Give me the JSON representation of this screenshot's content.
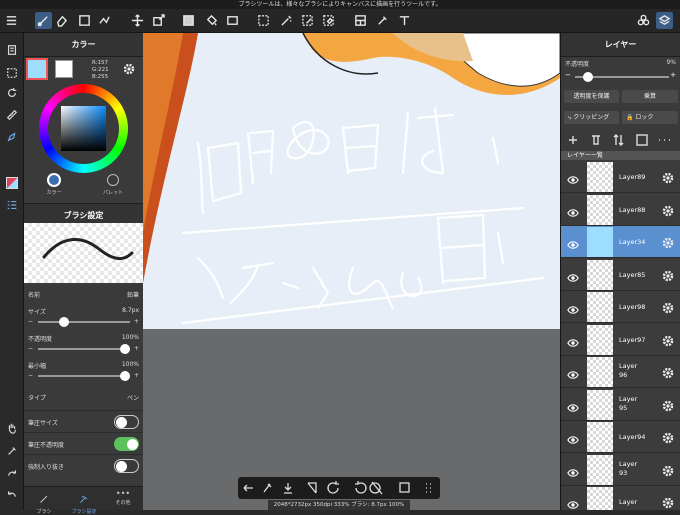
{
  "hint_text": "ブラシツールは、様々なブラシによりキャンバスに描画を行うツールです。",
  "color_panel": {
    "title": "カラー",
    "r": "R:157",
    "g": "G:221",
    "b": "B:255",
    "current_color": "#9dddff",
    "tab_color": "カラー",
    "tab_palette": "パレット"
  },
  "brush_panel": {
    "title": "ブラシ設定",
    "name_label": "名前",
    "name_value": "鉛筆",
    "size_label": "サイズ",
    "size_value": "8.7px",
    "opacity_label": "不透明度",
    "opacity_value": "100%",
    "min_width_label": "最小幅",
    "min_width_value": "100%",
    "type_label": "タイプ",
    "type_value": "ペン",
    "pressure_size_label": "筆圧サイズ",
    "pressure_opacity_label": "筆圧不透明度",
    "force_fade_label": "強制入り抜き",
    "toggles": {
      "pressure_size": false,
      "pressure_opacity": true,
      "force_fade": false
    },
    "size_level": 0.26,
    "opacity_level": 1.0,
    "min_width_level": 1.0
  },
  "bottom_tabs": {
    "brush": "ブラシ",
    "brush_settings": "ブラシ設定",
    "other": "その他"
  },
  "layer_panel": {
    "title": "レイヤー",
    "opacity_label": "不透明度",
    "opacity_value": "9%",
    "opacity_level": 0.09,
    "protect_label": "透明度を保護",
    "blend_label": "乗算",
    "clipping_label": "クリッピング",
    "lock_label": "ロック",
    "list_title": "レイヤー一覧",
    "layers": [
      {
        "name": "Layer89",
        "selected": false
      },
      {
        "name": "Layer88",
        "selected": false
      },
      {
        "name": "Layer34",
        "selected": true
      },
      {
        "name": "Layer85",
        "selected": false
      },
      {
        "name": "Layer98",
        "selected": false
      },
      {
        "name": "Layer97",
        "selected": false
      },
      {
        "name": "Layer 96",
        "selected": false
      },
      {
        "name": "Layer 95",
        "selected": false
      },
      {
        "name": "Layer94",
        "selected": false
      },
      {
        "name": "Layer 93",
        "selected": false
      },
      {
        "name": "Layer",
        "selected": false
      }
    ]
  },
  "status_text": "2048*2732px 350dpi 333% ブラシ: 8.7px 100%",
  "colors": {
    "accent": "#5a8fd0",
    "canvas_bg": "#e8eef7",
    "toggle_on": "#5cc15c"
  }
}
